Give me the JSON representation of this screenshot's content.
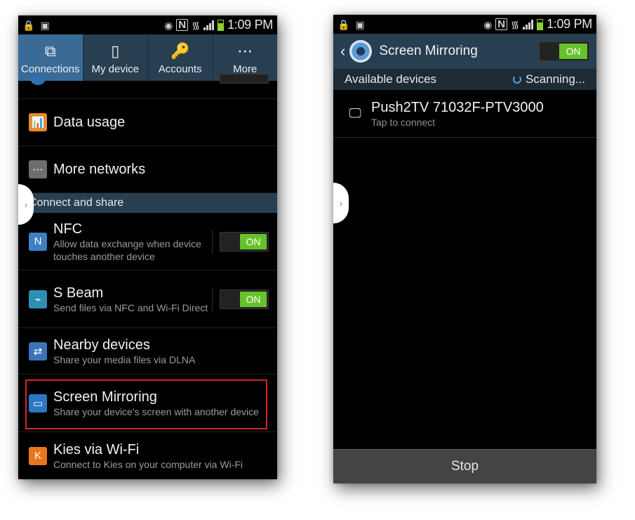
{
  "status_bar": {
    "time": "1:09 PM",
    "nfc_letter": "N"
  },
  "left": {
    "tabs": [
      {
        "label": "Connections",
        "icon": "connections-icon"
      },
      {
        "label": "My device",
        "icon": "my-device-icon"
      },
      {
        "label": "Accounts",
        "icon": "accounts-icon"
      },
      {
        "label": "More",
        "icon": "more-icon"
      }
    ],
    "rows": {
      "data_usage": {
        "title": "Data usage"
      },
      "more_networks": {
        "title": "More networks"
      },
      "nfc": {
        "title": "NFC",
        "sub": "Allow data exchange when device touches another device",
        "toggle": "ON"
      },
      "s_beam": {
        "title": "S Beam",
        "sub": "Send files via NFC and Wi-Fi Direct",
        "toggle": "ON"
      },
      "nearby": {
        "title": "Nearby devices",
        "sub": "Share your media files via DLNA"
      },
      "mirroring": {
        "title": "Screen Mirroring",
        "sub": "Share your device's screen with another device"
      },
      "kies": {
        "title": "Kies via Wi-Fi",
        "sub": "Connect to Kies on your computer via Wi-Fi"
      }
    },
    "section_header": "Connect and share",
    "colors": {
      "highlight": "#d8232a",
      "toggle_on": "#66c22a"
    }
  },
  "right": {
    "title": "Screen Mirroring",
    "toggle": "ON",
    "available_label": "Available devices",
    "scanning_label": "Scanning...",
    "device": {
      "name": "Push2TV 71032F-PTV3000",
      "sub": "Tap to connect"
    },
    "stop_label": "Stop"
  }
}
